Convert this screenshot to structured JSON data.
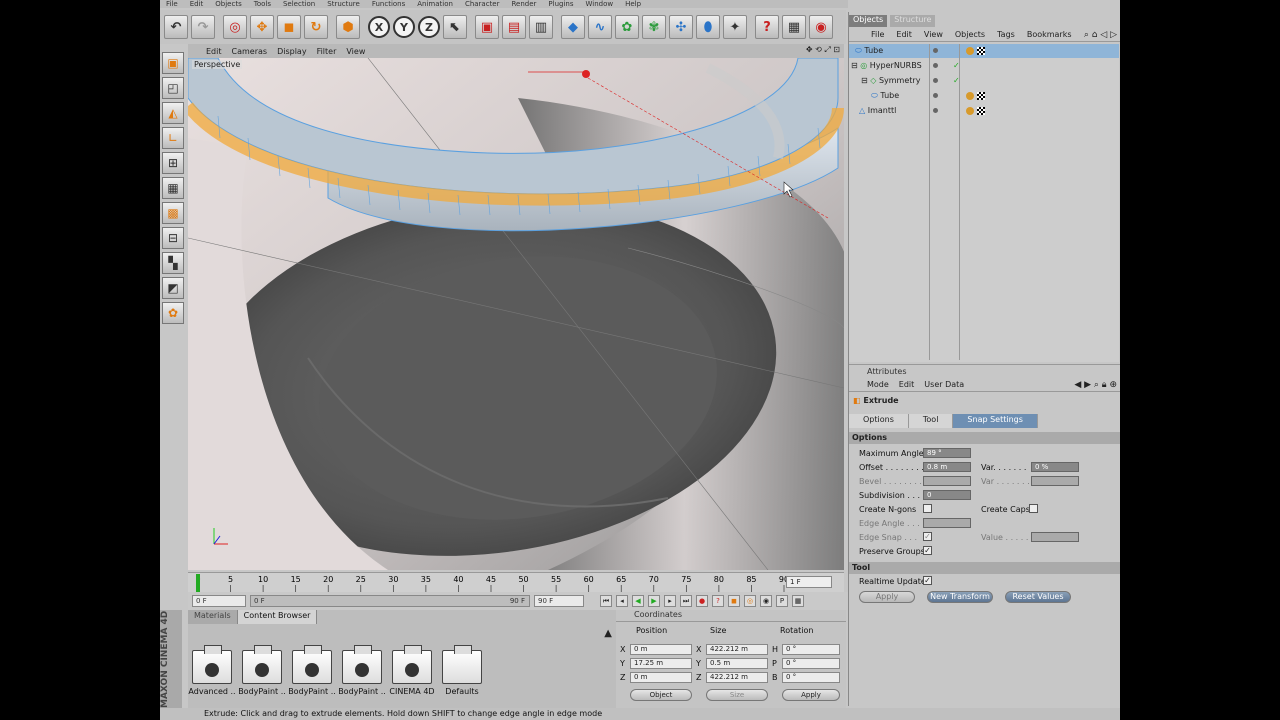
{
  "menu": [
    "File",
    "Edit",
    "Objects",
    "Tools",
    "Selection",
    "Structure",
    "Functions",
    "Animation",
    "Character",
    "Render",
    "Plugins",
    "Window",
    "Help"
  ],
  "viewport": {
    "menu": [
      "Edit",
      "Cameras",
      "Display",
      "Filter",
      "View"
    ],
    "label": "Perspective",
    "nav_icons": "✥ ⟲ ⤢ ⊡"
  },
  "timeline": {
    "ticks": [
      "0",
      "5",
      "10",
      "15",
      "20",
      "25",
      "30",
      "35",
      "40",
      "45",
      "50",
      "55",
      "60",
      "65",
      "70",
      "75",
      "80",
      "85",
      "90"
    ],
    "frame_field": "1 F"
  },
  "playbar": {
    "current": "0 F",
    "start": "0 F",
    "range_end": "90 F",
    "end": "90 F"
  },
  "materials": {
    "tabs": [
      "Materials",
      "Content Browser"
    ],
    "items": [
      "Advanced ..",
      "BodyPaint ..",
      "BodyPaint ..",
      "BodyPaint ..",
      "CINEMA 4D",
      "Defaults"
    ],
    "brand": "MAXON CINEMA 4D"
  },
  "coordinates": {
    "title": "Coordinates",
    "columns": [
      "Position",
      "Size",
      "Rotation"
    ],
    "rows": [
      {
        "axis": "X",
        "pos": "0 m",
        "size_axis": "X",
        "size": "422.212 m",
        "rot_axis": "H",
        "rot": "0 °"
      },
      {
        "axis": "Y",
        "pos": "17.25 m",
        "size_axis": "Y",
        "size": "0.5 m",
        "rot_axis": "P",
        "rot": "0 °"
      },
      {
        "axis": "Z",
        "pos": "0 m",
        "size_axis": "Z",
        "size": "422.212 m",
        "rot_axis": "B",
        "rot": "0 °"
      }
    ],
    "mode": "Object",
    "size_mode": "Size",
    "apply": "Apply"
  },
  "objects": {
    "tabs": [
      "Objects",
      "Structure"
    ],
    "menu": [
      "File",
      "Edit",
      "View",
      "Objects",
      "Tags",
      "Bookmarks"
    ],
    "tree": [
      {
        "name": "Tube",
        "indent": 0,
        "selected": true,
        "tags": [
          "mat",
          "checker"
        ]
      },
      {
        "name": "HyperNURBS",
        "indent": 0,
        "selected": false,
        "tags": []
      },
      {
        "name": "Symmetry",
        "indent": 1,
        "selected": false,
        "tags": []
      },
      {
        "name": "Tube",
        "indent": 2,
        "selected": false,
        "tags": [
          "mat",
          "checker"
        ]
      },
      {
        "name": "Imanttl",
        "indent": 0,
        "selected": false,
        "tags": [
          "mat",
          "checker"
        ]
      }
    ]
  },
  "attributes": {
    "title": "Attributes",
    "menu": [
      "Mode",
      "Edit",
      "User Data"
    ],
    "tool_name": "Extrude",
    "tabs": [
      "Options",
      "Tool",
      "Snap Settings"
    ],
    "options_header": "Options",
    "max_angle_label": "Maximum Angle",
    "max_angle": "89 °",
    "offset_label": "Offset . . . . . . . .",
    "offset": "0.8 m",
    "var_label": "Var. . . . . . .",
    "var": "0 %",
    "bevel_label": "Bevel . . . . . . . .",
    "var2_label": "Var . . . . . . .",
    "subdivision_label": "Subdivision . . .",
    "subdivision": "0",
    "create_ngons_label": "Create N-gons",
    "create_caps_label": "Create Caps",
    "edge_angle_label": "Edge Angle . . .",
    "edge_snap_label": "Edge Snap . . .",
    "value_label": "Value . . . . . .",
    "preserve_groups_label": "Preserve Groups",
    "tool_header": "Tool",
    "realtime_label": "Realtime Update",
    "apply": "Apply",
    "new_transform": "New Transform",
    "reset_values": "Reset Values"
  },
  "status": "Extrude: Click and drag to extrude elements. Hold down SHIFT to change edge angle in edge mode"
}
